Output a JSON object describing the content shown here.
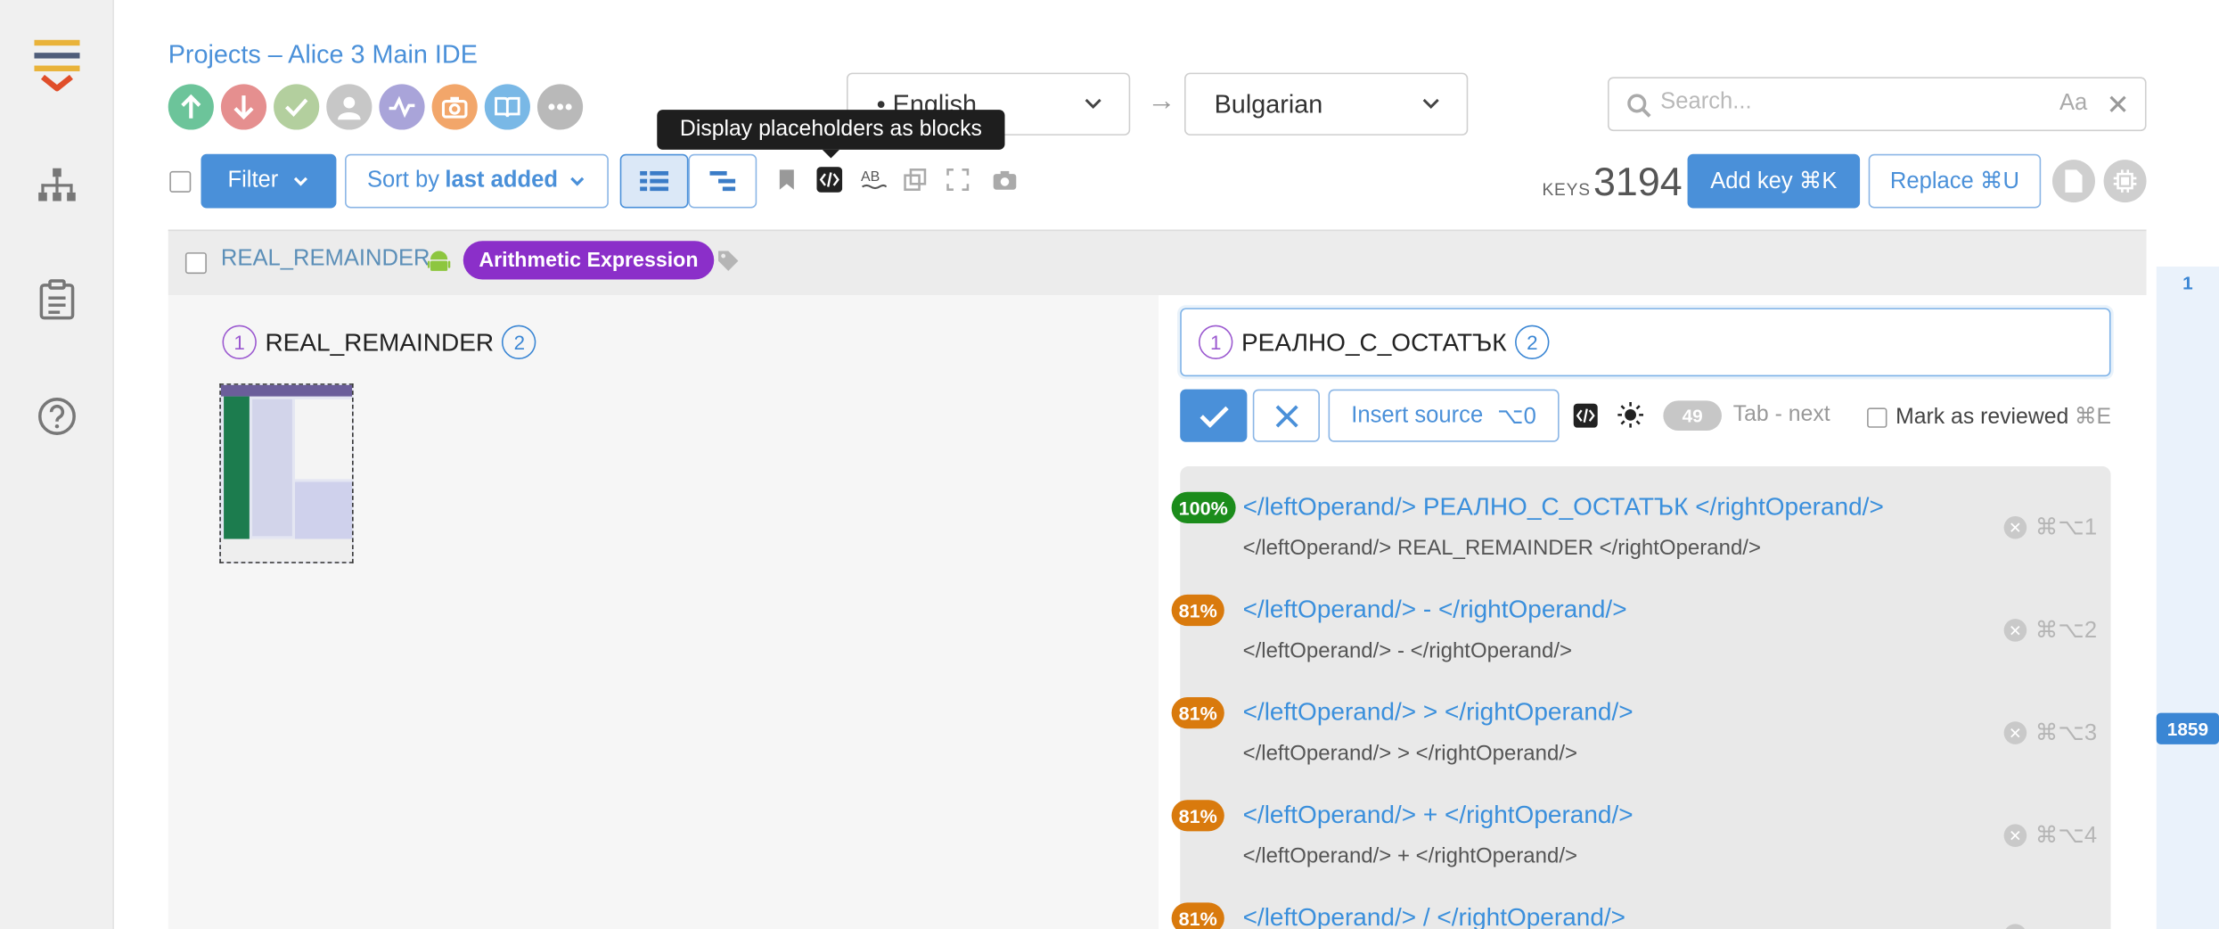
{
  "header": {
    "breadcrumb": "Projects – Alice 3 Main IDE",
    "source_language": "• English",
    "target_language": "Bulgarian",
    "search_placeholder": "Search...",
    "case_toggle": "Aa"
  },
  "toolbar": {
    "filter_label": "Filter",
    "sort_prefix": "Sort by",
    "sort_value": "last added",
    "tooltip": "Display placeholders as blocks",
    "keys_label": "KEYS",
    "keys_count": "3194",
    "add_key_label": "Add key ⌘K",
    "replace_label": "Replace ⌘U"
  },
  "key": {
    "name": "REAL_REMAINDER",
    "tag": "Arithmetic Expression",
    "source_text": "REAL_REMAINDER",
    "translation_text": "РЕАЛНО_С_ОСТАТЪК",
    "placeholder_1": "1",
    "placeholder_2": "2"
  },
  "editor": {
    "insert_source_label": "Insert source",
    "insert_source_shortcut": "⌥0",
    "count": "49",
    "tab_next": "Tab - next",
    "mark_reviewed": "Mark as reviewed",
    "mark_reviewed_shortcut": "⌘E"
  },
  "suggestions": [
    {
      "percent": "100%",
      "color": "#1b8c1b",
      "translation": "</leftOperand/> РЕАЛНО_С_ОСТАТЪК </rightOperand/>",
      "source": "</leftOperand/> REAL_REMAINDER </rightOperand/>",
      "shortcut": "⌘⌥1"
    },
    {
      "percent": "81%",
      "color": "#d97a0d",
      "translation": "</leftOperand/> - </rightOperand/>",
      "source": "</leftOperand/> - </rightOperand/>",
      "shortcut": "⌘⌥2"
    },
    {
      "percent": "81%",
      "color": "#d97a0d",
      "translation": "</leftOperand/> > </rightOperand/>",
      "source": "</leftOperand/> > </rightOperand/>",
      "shortcut": "⌘⌥3"
    },
    {
      "percent": "81%",
      "color": "#d97a0d",
      "translation": "</leftOperand/> + </rightOperand/>",
      "source": "</leftOperand/> + </rightOperand/>",
      "shortcut": "⌘⌥4"
    },
    {
      "percent": "81%",
      "color": "#d97a0d",
      "translation": "</leftOperand/> / </rightOperand/>",
      "source": "",
      "shortcut": ""
    }
  ],
  "scrollbar": {
    "top_number": "1",
    "marker_number": "1859"
  },
  "status_icons": [
    "upload-icon",
    "download-icon",
    "check-icon",
    "user-icon",
    "activity-icon",
    "camera-icon",
    "book-icon",
    "more-icon"
  ],
  "colors": {
    "accent": "#4a90d9",
    "tag": "#8b2fc9",
    "match_100": "#1b8c1b",
    "match_81": "#d97a0d"
  }
}
